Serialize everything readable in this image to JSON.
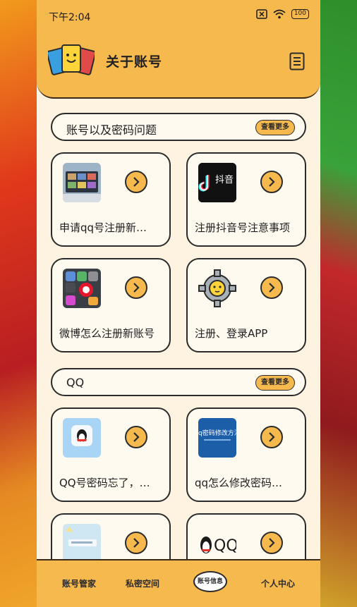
{
  "status": {
    "time": "下午2:04",
    "battery": "100"
  },
  "header": {
    "title": "关于账号"
  },
  "sections": [
    {
      "title": "账号以及密码问题",
      "more": "查看更多",
      "cards": [
        {
          "label": "申请qq号注册新…",
          "thumb": "tablet-photo"
        },
        {
          "label": "注册抖音号注意事项",
          "thumb": "douyin-logo",
          "thumb_text": "抖音"
        },
        {
          "label": "微博怎么注册新账号",
          "thumb": "phone-apps-photo"
        },
        {
          "label": "注册、登录APP",
          "thumb": "gear-emoji"
        }
      ]
    },
    {
      "title": "QQ",
      "more": "查看更多",
      "cards": [
        {
          "label": "QQ号密码忘了，…",
          "thumb": "qq-app-icon"
        },
        {
          "label": "qq怎么修改密码…",
          "thumb": "blue-banner",
          "thumb_text": "q密码修改方法"
        },
        {
          "label": "",
          "thumb": "pastel-screenshot"
        },
        {
          "label": "",
          "thumb": "qq-penguin-logo",
          "thumb_text": "QQ"
        }
      ]
    }
  ],
  "tabs": [
    {
      "label": "账号管家"
    },
    {
      "label": "私密空间"
    },
    {
      "label": "账号信息"
    },
    {
      "label": "个人中心"
    }
  ],
  "colors": {
    "accent": "#f6b94e",
    "panel": "#fdf3e0",
    "outline": "#2b2b2b"
  }
}
